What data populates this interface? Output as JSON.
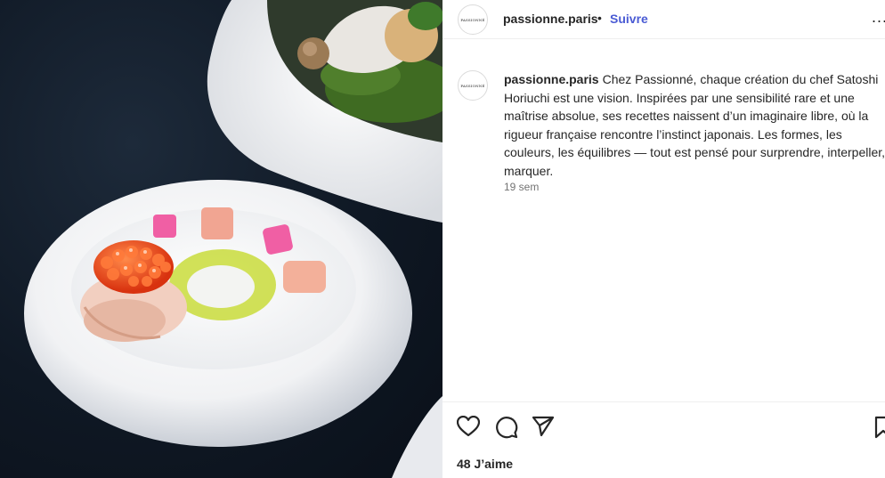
{
  "header": {
    "avatar_text": "PASSIONNÉ",
    "username": "passionne.paris",
    "separator": "•",
    "follow_label": "Suivre",
    "more_label": "..."
  },
  "caption": {
    "avatar_text": "PASSIONNÉ",
    "username": "passionne.paris",
    "text": "Chez Passionné, chaque création du chef Satoshi Horiuchi est une vision. Inspirées par une sensibilité rare et une maîtrise absolue, ses recettes naissent d’un imaginaire libre, où la rigueur française rencontre l’instinct japonais. Les formes, les couleurs, les équilibres — tout est pensé pour surprendre, interpeller, marquer.",
    "time": "19 sem"
  },
  "actions": {
    "like_icon": "heart-icon",
    "comment_icon": "comment-icon",
    "share_icon": "paper-plane-icon",
    "save_icon": "bookmark-icon",
    "likes": "48 J’aime",
    "sub": "..."
  },
  "photo": {
    "description_icon": "food-plate-photo"
  }
}
